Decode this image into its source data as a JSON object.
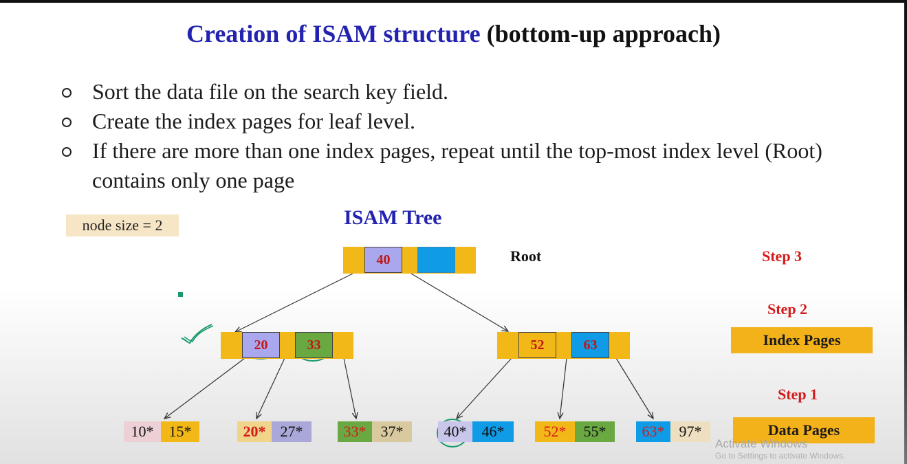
{
  "slide": {
    "title_blue": "Creation of ISAM structure",
    "title_black": "(bottom-up approach)",
    "bullets": [
      "Sort the data file on the search key field.",
      "Create the index pages for leaf level.",
      "If there are more than one index pages, repeat until the top-most index level (Root) contains only one page"
    ],
    "node_size_note": "node size = 2",
    "tree_title": "ISAM Tree",
    "root_label": "Root",
    "steps": {
      "step3": "Step 3",
      "step2": "Step 2",
      "step1": "Step 1"
    },
    "bands": {
      "index_pages": "Index Pages",
      "data_pages": "Data Pages"
    }
  },
  "tree": {
    "root": {
      "keys": [
        "40",
        ""
      ]
    },
    "index": [
      {
        "keys": [
          "20",
          "33"
        ]
      },
      {
        "keys": [
          "52",
          "63"
        ]
      }
    ],
    "data_pages": [
      [
        "10*",
        "15*"
      ],
      [
        "20*",
        "27*"
      ],
      [
        "33*",
        "37*"
      ],
      [
        "40*",
        "46*"
      ],
      [
        "52*",
        "55*"
      ],
      [
        "63*",
        "97*"
      ]
    ]
  },
  "colors": {
    "node_fill": "#f2b818",
    "key_purple": "#a9a8ee",
    "key_blue": "#0f9be6",
    "key_green": "#6aa842",
    "title_blue": "#2323b0",
    "step_red": "#d41a1a",
    "annotation_green": "#1a9a6a"
  },
  "watermark": {
    "line1": "Activate Windows",
    "line2": "Go to Settings to activate Windows."
  }
}
